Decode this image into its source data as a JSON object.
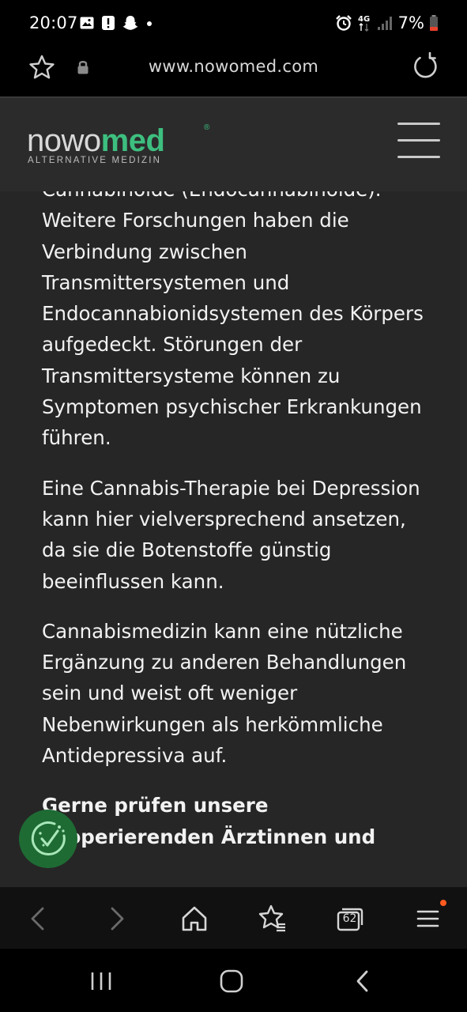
{
  "status_bar": {
    "time": "20:07",
    "network": "4G",
    "battery": "7%",
    "icons_left": [
      "gallery-icon",
      "alert-icon",
      "snapchat-icon",
      "dot-icon"
    ],
    "icons_right": [
      "alarm-icon",
      "network-4g-icon",
      "signal-icon",
      "battery-low-icon"
    ]
  },
  "browser": {
    "url": "www.nowomed.com",
    "open_tabs": "62"
  },
  "site_header": {
    "logo_part1": "nowo",
    "logo_part2": "med",
    "logo_registered": "®",
    "logo_tagline": "ALTERNATIVE MEDIZIN",
    "accent_color": "#3dbf7f"
  },
  "article": {
    "paragraphs": [
      "Cannabinoide (Endocannabinoide). Weitere Forschungen haben die Verbindung zwischen Transmittersystemen und Endocannabionidsystemen des Körpers aufgedeckt. Störungen der Transmittersysteme können zu Symptomen psychischer Erkrankungen führen.",
      "Eine Cannabis-Therapie bei Depression kann hier vielversprechend ansetzen, da sie die Botenstoffe günstig beeinflussen kann.",
      "Cannabismedizin kann eine nützliche Ergänzung zu anderen Behandlungen sein und weist oft weniger Nebenwirkungen als herkömmliche Antidepressiva auf.",
      "Gerne prüfen unsere kooperierenden Ärztinnen und"
    ]
  }
}
